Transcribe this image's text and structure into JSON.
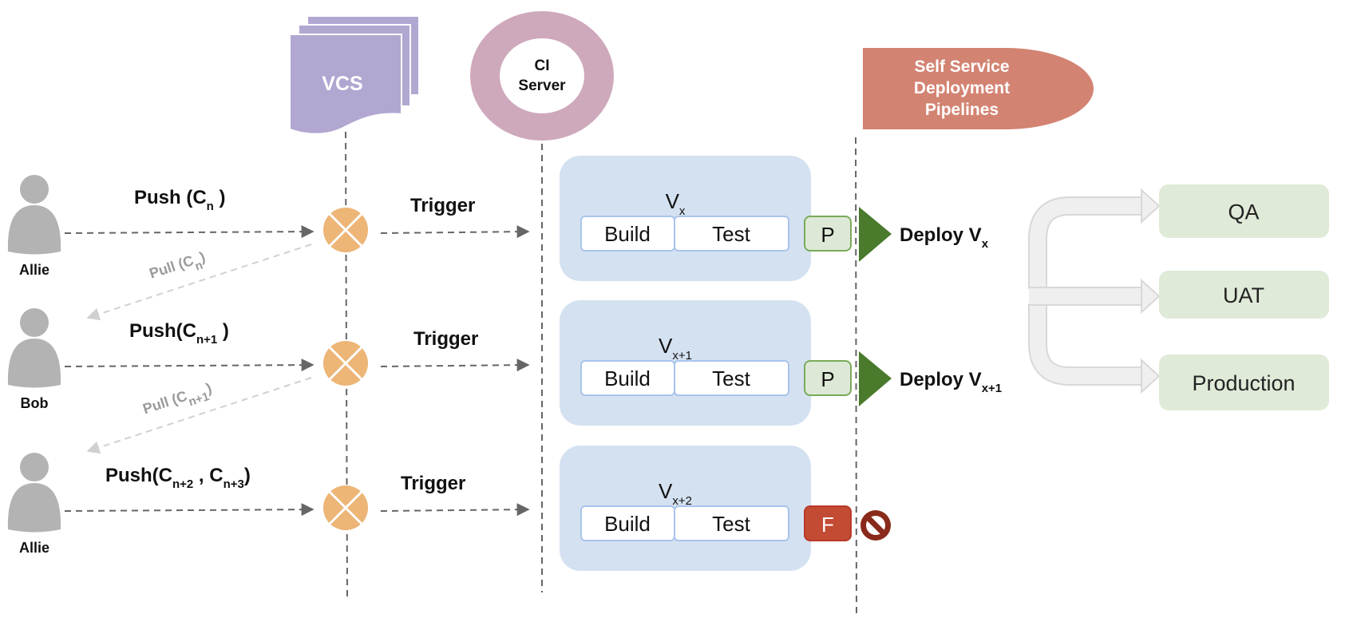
{
  "vcs": {
    "label": "VCS",
    "color": "#b1a7d1"
  },
  "ci_server": {
    "line1": "CI",
    "line2": "Server",
    "color": "#cea8bb"
  },
  "pipelines": {
    "line1": "Self Service",
    "line2": "Deployment",
    "line3": "Pipelines",
    "color": "#d38372"
  },
  "rows": [
    {
      "user": "Allie",
      "push": "Push (C",
      "push_sub": "n",
      "push_end": " )",
      "push_sub2": "",
      "push_mid": "",
      "push_end2": "",
      "pull": "Pull (C",
      "pull_sub": "n",
      "pull_end": ")",
      "trigger": "Trigger",
      "version": "V",
      "version_sub": "x",
      "build": "Build",
      "test": "Test",
      "result": "P",
      "status": "pass",
      "deploy": "Deploy V",
      "deploy_sub": "x"
    },
    {
      "user": "Bob",
      "push": "Push(C",
      "push_sub": "n+1",
      "push_end": " )",
      "pull": "Pull (C",
      "pull_sub": "n+1",
      "pull_end": ")",
      "trigger": "Trigger",
      "version": "V",
      "version_sub": "x+1",
      "build": "Build",
      "test": "Test",
      "result": "P",
      "status": "pass",
      "deploy": "Deploy V",
      "deploy_sub": "x+1"
    },
    {
      "user": "Allie",
      "push": "Push(C",
      "push_sub": "n+2",
      "push_mid": " , C",
      "push_sub2": "n+3",
      "push_end": ")",
      "trigger": "Trigger",
      "version": "V",
      "version_sub": "x+2",
      "build": "Build",
      "test": "Test",
      "result": "F",
      "status": "fail",
      "blocked_icon": "no-entry-icon"
    }
  ],
  "environments": [
    "QA",
    "UAT",
    "Production"
  ],
  "colors": {
    "stage_bg": "#d4e1f0",
    "pass_fill": "#dde9d6",
    "pass_border": "#7aaa5a",
    "fail_fill": "#c34a33",
    "deploy_arrow": "#4a7a2c",
    "merge": "#edb576",
    "env_bg": "#dfead8",
    "blocked": "#8a2a1a"
  }
}
